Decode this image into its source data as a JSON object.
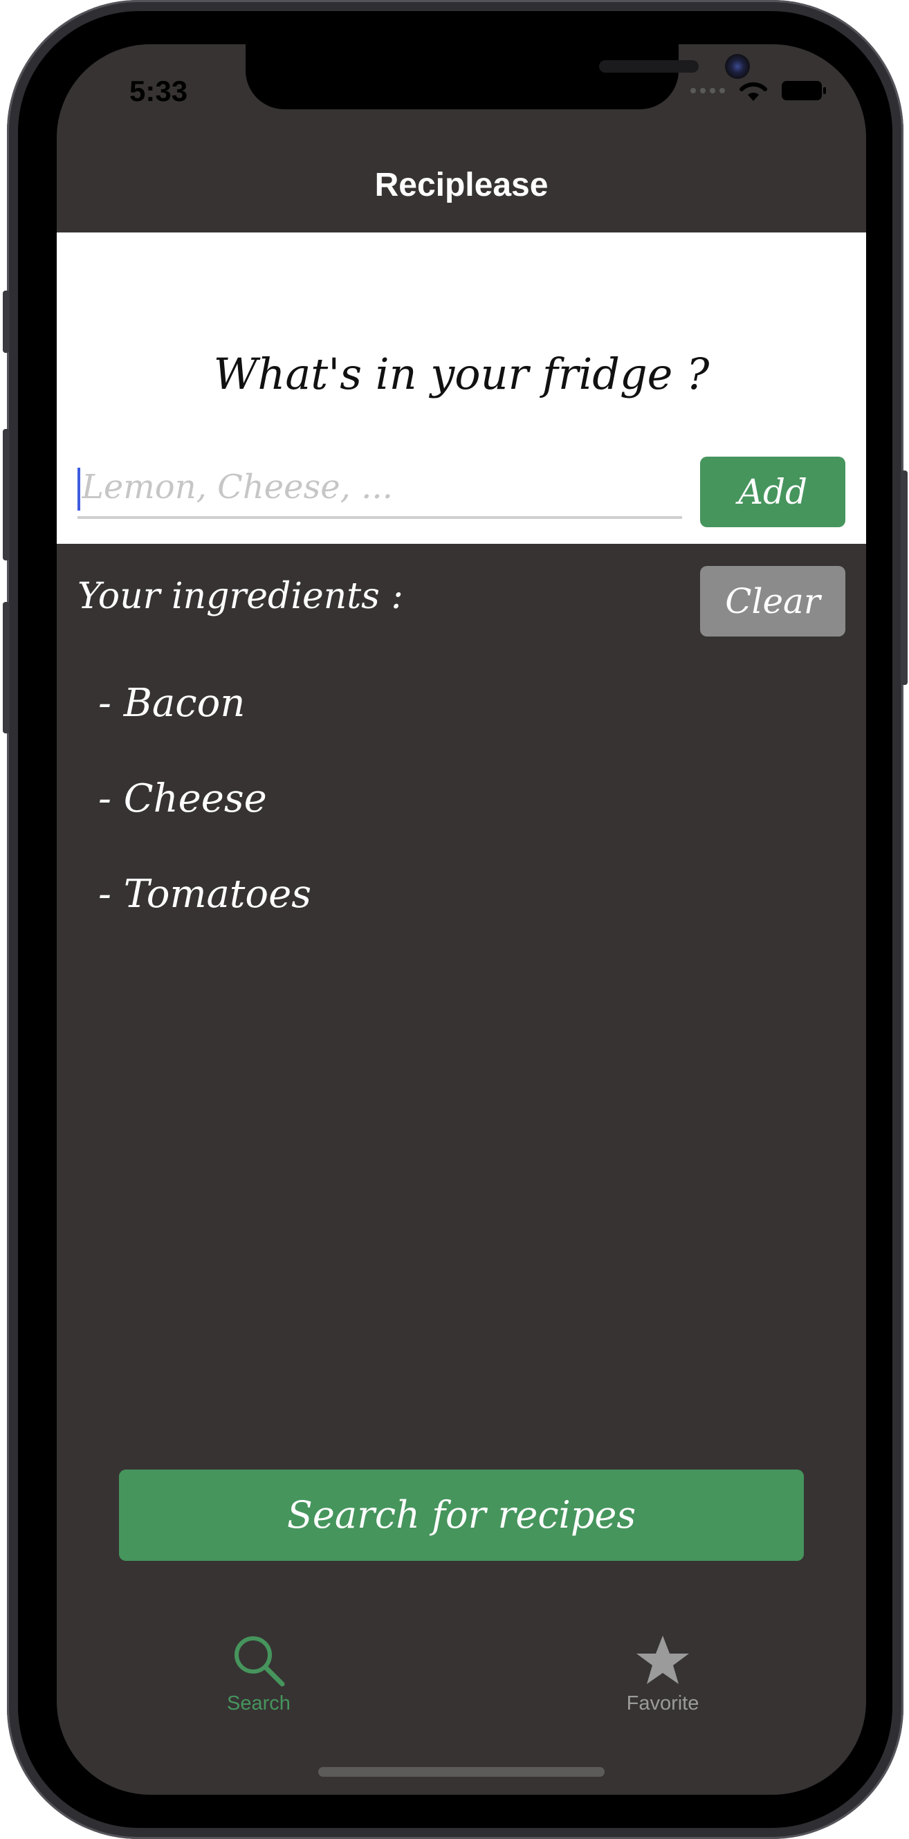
{
  "status_bar": {
    "time": "5:33",
    "icons": [
      "signal-dots-icon",
      "wifi-icon",
      "battery-icon"
    ]
  },
  "nav": {
    "title": "Reciplease"
  },
  "header": {
    "question": "What's in your fridge ?"
  },
  "input": {
    "placeholder": "Lemon, Cheese, ...",
    "value": ""
  },
  "buttons": {
    "add": "Add",
    "clear": "Clear",
    "search": "Search for recipes"
  },
  "ingredients": {
    "label": "Your ingredients :",
    "items": [
      "- Bacon",
      "- Cheese",
      "- Tomatoes"
    ]
  },
  "tabbar": {
    "tabs": [
      {
        "label": "Search",
        "icon": "magnifier-icon",
        "selected": true
      },
      {
        "label": "Favorite",
        "icon": "star-icon",
        "selected": false
      }
    ]
  },
  "colors": {
    "accent_green": "#46955d",
    "background_dark": "#373333",
    "clear_gray": "#8c8b8b"
  }
}
